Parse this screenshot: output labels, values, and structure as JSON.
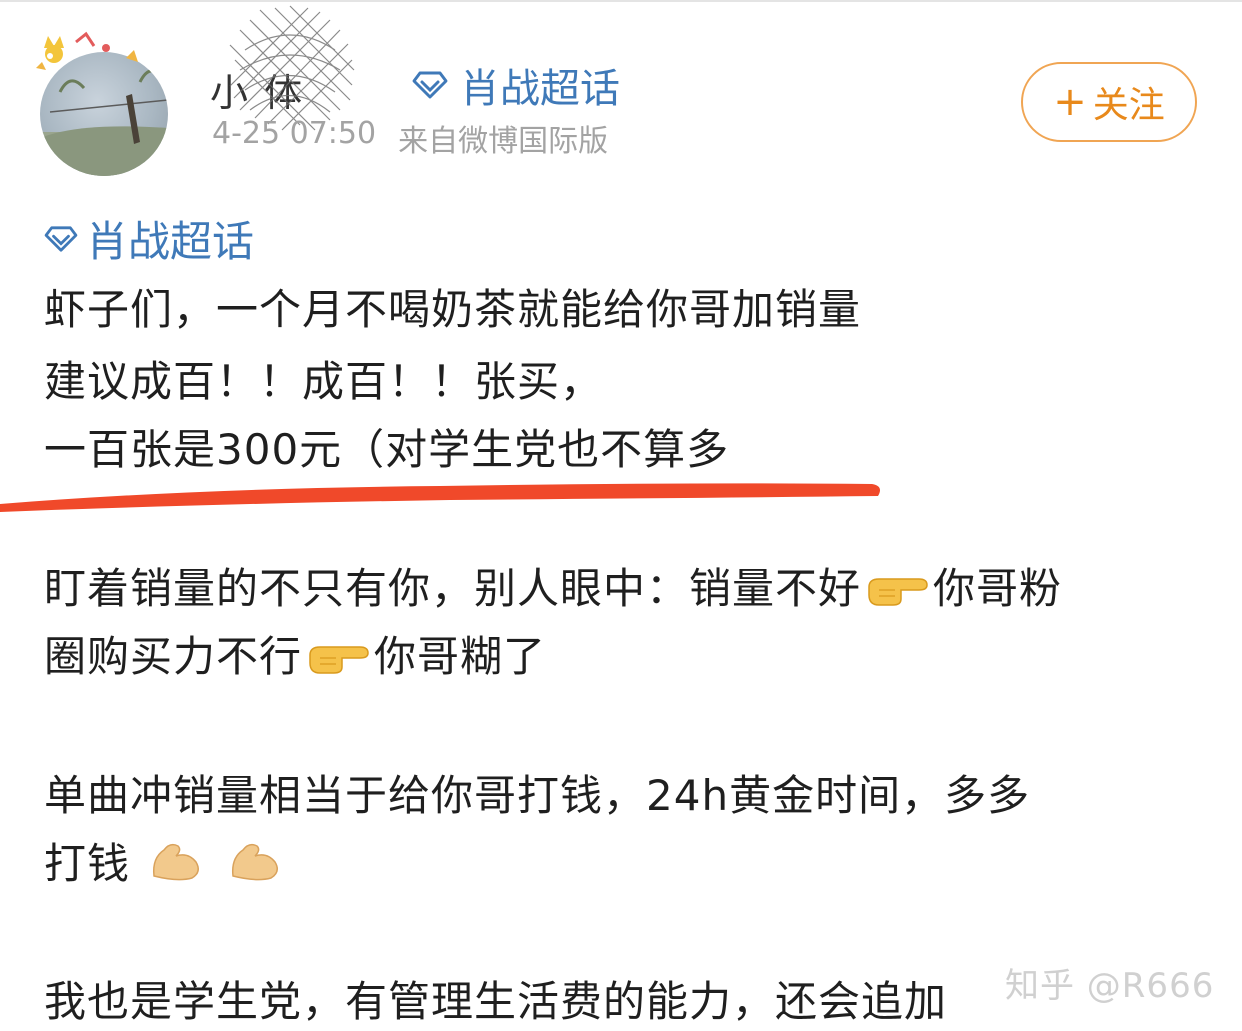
{
  "header": {
    "username": "小 体",
    "topic_tag": "肖战超话",
    "timestamp": "4-25 07:50",
    "source": "来自微博国际版",
    "follow_label": "关注"
  },
  "post": {
    "topic_tag": "肖战超话",
    "line1": "虾子们，一个月不喝奶茶就能给你哥加销量",
    "line2": "建议成百！！成百！！张买，",
    "line3": "一百张是300元（对学生党也不算多",
    "line4_a": "盯着销量的不只有你，别人眼中：销量不好",
    "line4_b": "你哥粉",
    "line5_a": "圈购买力不行",
    "line5_b": "你哥糊了",
    "line6": "单曲冲销量相当于给你哥打钱，24h黄金时间，多多",
    "line7": "打钱",
    "line8": "我也是学生党，有管理生活费的能力，还会追加"
  },
  "watermark": "知乎 @R666",
  "colors": {
    "topic_blue": "#3f79b8",
    "follow_orange": "#e8891b",
    "underline_red": "#f0492a"
  },
  "icons": [
    "diamond-icon",
    "plus-icon",
    "pointing-right-icon",
    "flexed-biceps-icon"
  ]
}
